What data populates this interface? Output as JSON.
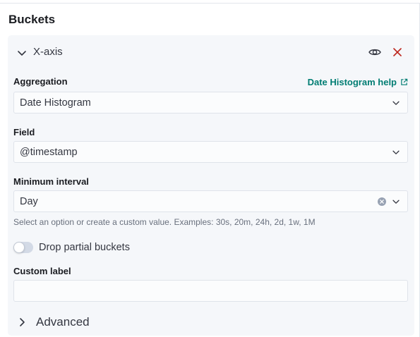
{
  "section": {
    "title": "Buckets"
  },
  "bucket": {
    "title": "X-axis",
    "aggregation": {
      "label": "Aggregation",
      "help_link": "Date Histogram help",
      "value": "Date Histogram"
    },
    "field": {
      "label": "Field",
      "value": "@timestamp"
    },
    "interval": {
      "label": "Minimum interval",
      "value": "Day",
      "help": "Select an option or create a custom value. Examples: 30s, 20m, 24h, 2d, 1w, 1M"
    },
    "drop_partial": {
      "label": "Drop partial buckets",
      "checked": false
    },
    "custom_label": {
      "label": "Custom label",
      "value": ""
    },
    "advanced": {
      "label": "Advanced"
    }
  },
  "icons": {
    "collapse": "chevron-down-icon",
    "expand": "chevron-right-icon",
    "visibility": "eye-icon",
    "remove": "close-icon",
    "external": "external-link-icon",
    "dropdown": "chevron-down-icon",
    "clear": "clear-icon"
  },
  "colors": {
    "link": "#017d73",
    "danger": "#bd271e",
    "panel_bg": "#f5f7fa"
  }
}
